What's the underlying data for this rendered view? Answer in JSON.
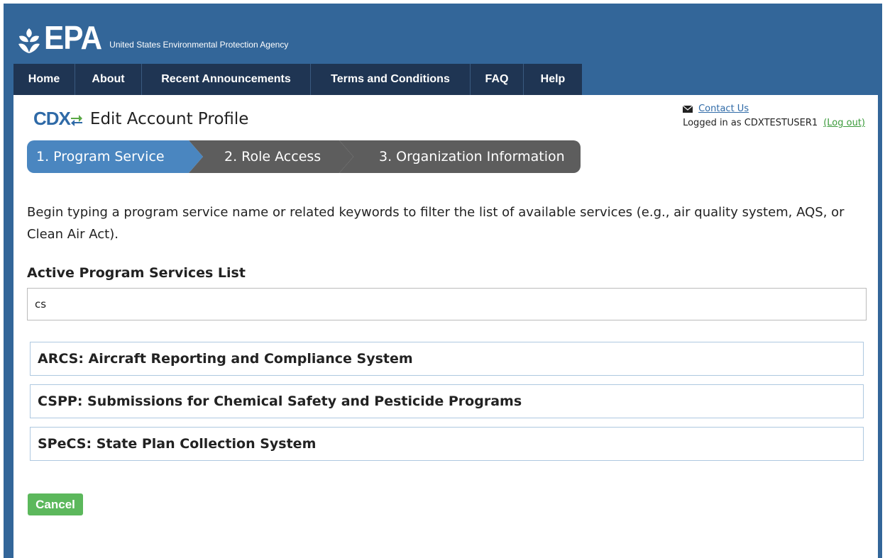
{
  "header": {
    "logo_text": "EPA",
    "agency_name": "United States Environmental Protection Agency"
  },
  "nav": {
    "items": [
      {
        "label": "Home"
      },
      {
        "label": "About"
      },
      {
        "label": "Recent Announcements"
      },
      {
        "label": "Terms and Conditions"
      },
      {
        "label": "FAQ"
      },
      {
        "label": "Help"
      }
    ]
  },
  "page": {
    "app_logo_text": "CDX",
    "title": "Edit Account Profile"
  },
  "user": {
    "contact_label": "Contact Us",
    "logged_in_text": "Logged in as CDXTESTUSER1",
    "logout_label": "(Log out)"
  },
  "steps": [
    {
      "label": "1. Program Service",
      "state": "active"
    },
    {
      "label": "2. Role Access",
      "state": "inactive"
    },
    {
      "label": "3. Organization Information",
      "state": "inactive"
    }
  ],
  "instructions": "Begin typing a program service name or related keywords to filter the list of available services (e.g., air quality system, AQS, or Clean Air Act).",
  "program_list": {
    "label": "Active Program Services List",
    "search_value": "cs",
    "results": [
      "ARCS: Aircraft Reporting and Compliance System",
      "CSPP: Submissions for Chemical Safety and Pesticide Programs",
      "SPeCS: State Plan Collection System"
    ]
  },
  "actions": {
    "cancel_label": "Cancel"
  },
  "colors": {
    "header_bg": "#336699",
    "nav_bg": "#1f3553",
    "step_active": "#4a86c0",
    "step_inactive": "#5d5d5d",
    "cancel_button": "#5cb85c",
    "list_border": "#aec8e0"
  }
}
